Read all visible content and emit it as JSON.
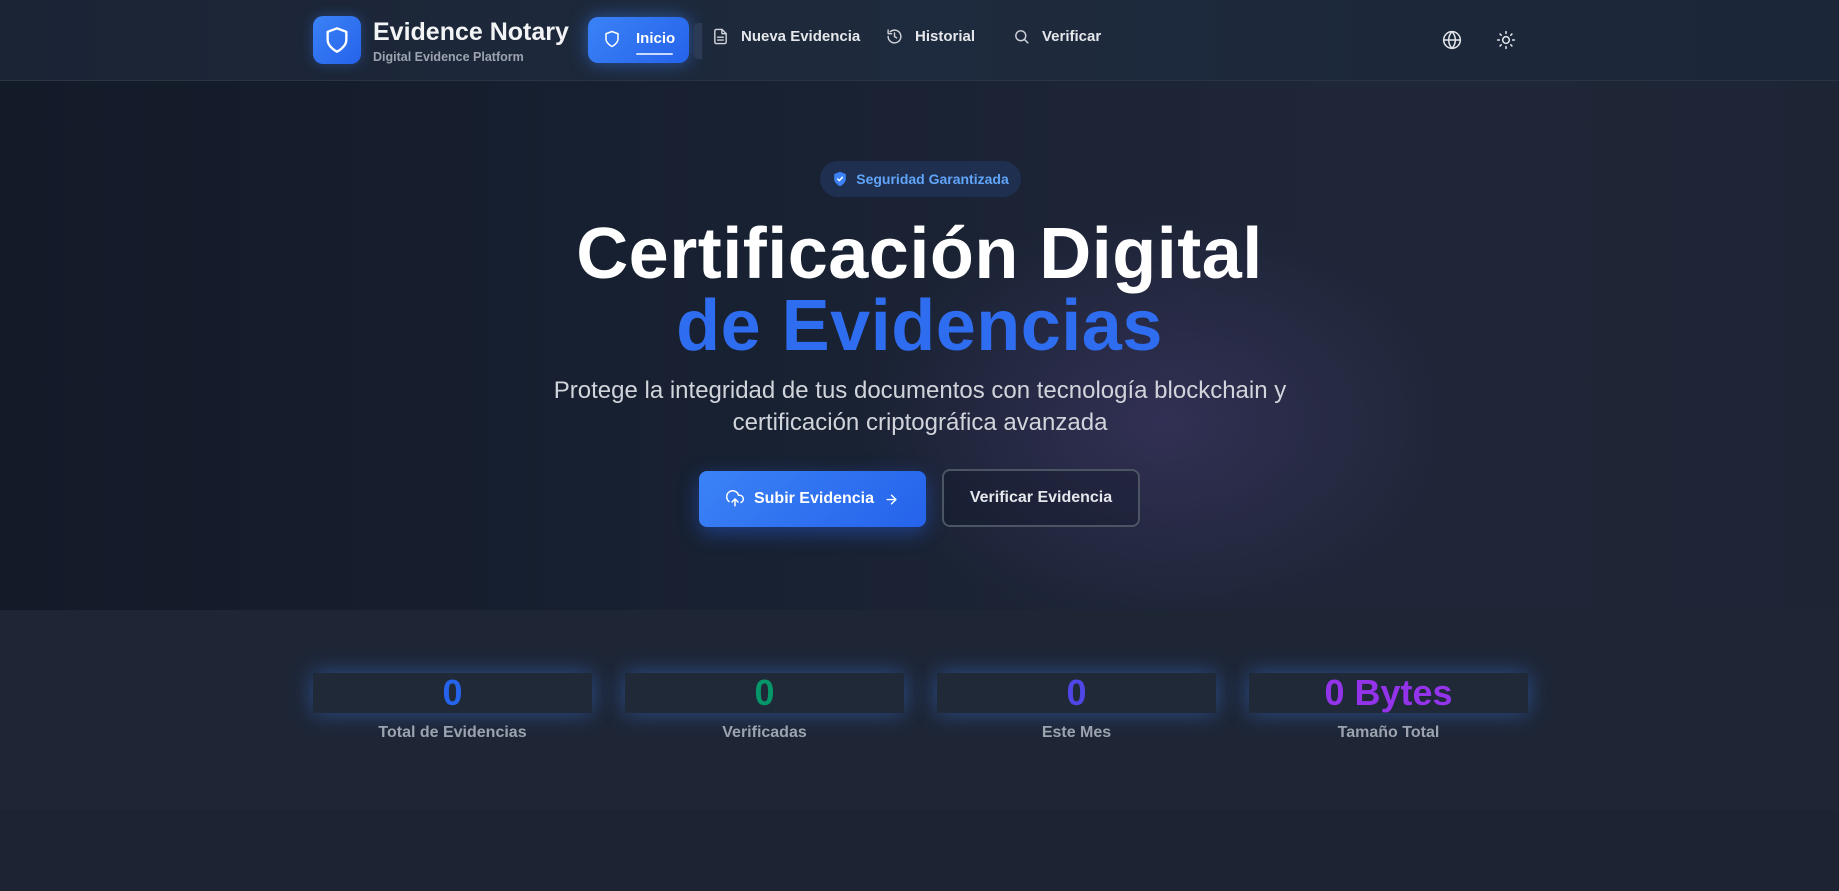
{
  "brand": {
    "title": "Evidence Notary",
    "subtitle": "Digital Evidence Platform",
    "logo_icon": "shield-icon"
  },
  "nav": {
    "items": [
      {
        "label": "Inicio",
        "icon": "shield-icon",
        "active": true
      },
      {
        "label": "Nueva Evidencia",
        "icon": "document-icon",
        "active": false
      },
      {
        "label": "Historial",
        "icon": "history-icon",
        "active": false
      },
      {
        "label": "Verificar",
        "icon": "search-icon",
        "active": false
      }
    ],
    "actions": [
      {
        "icon": "globe-icon"
      },
      {
        "icon": "sun-icon"
      }
    ]
  },
  "hero": {
    "badge": "Seguridad Garantizada",
    "title_line1": "Certificación Digital",
    "title_line2": "de Evidencias",
    "subtitle": "Protege la integridad de tus documentos con tecnología blockchain y certificación criptográfica avanzada",
    "primary_button": "Subir Evidencia",
    "secondary_button": "Verificar Evidencia"
  },
  "stats": [
    {
      "value": "0",
      "label": "Total de Evidencias",
      "color": "#2563eb"
    },
    {
      "value": "0",
      "label": "Verificadas",
      "color": "#059669"
    },
    {
      "value": "0",
      "label": "Este Mes",
      "color": "#4f46e5"
    },
    {
      "value": "0 Bytes",
      "label": "Tamaño Total",
      "color": "#9333ea"
    }
  ],
  "colors": {
    "accent": "#3b82f6",
    "accent_dark": "#2563eb",
    "background": "#1c2433"
  }
}
